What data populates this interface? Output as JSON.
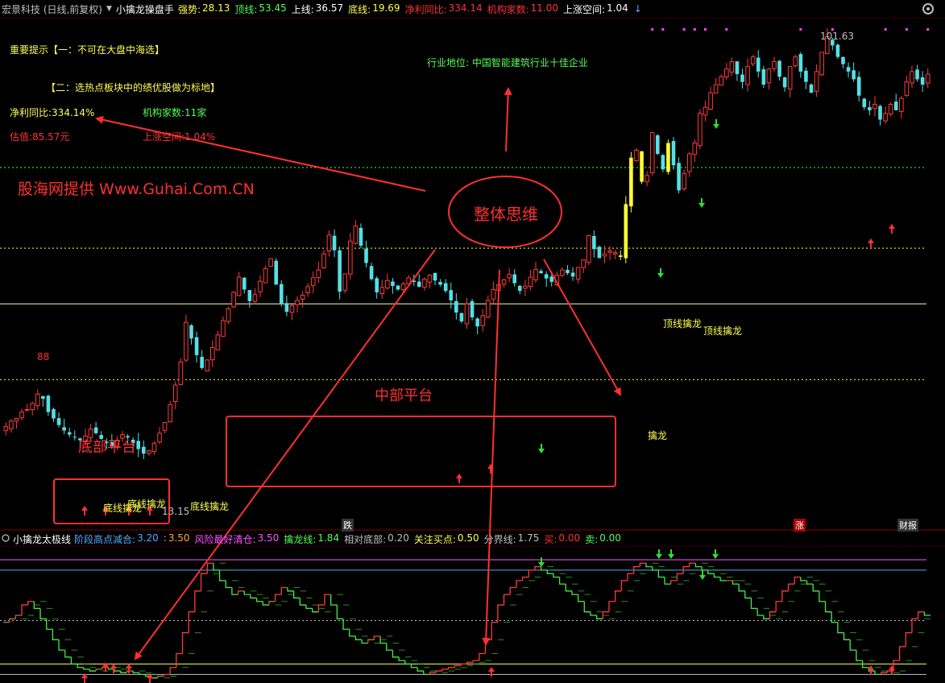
{
  "header": {
    "stock": "宏景科技 (日线,前复权)",
    "formula": "小擒龙操盘手",
    "items": [
      {
        "label": "强势:",
        "value": "28.13",
        "lc": "#ffff55",
        "vc": "#ffff55"
      },
      {
        "label": "顶线:",
        "value": "53.45",
        "lc": "#55ff55",
        "vc": "#55ff55"
      },
      {
        "label": "上线:",
        "value": "36.57",
        "lc": "#ffffff",
        "vc": "#ffffff"
      },
      {
        "label": "底线:",
        "value": "19.69",
        "lc": "#ffff55",
        "vc": "#ffff55"
      },
      {
        "label": "净利同比:",
        "value": "334.14",
        "lc": "#ff3333",
        "vc": "#ff3333"
      },
      {
        "label": "机构家数:",
        "value": "11.00",
        "lc": "#ff3333",
        "vc": "#ff3333"
      },
      {
        "label": "上涨空间:",
        "value": "1.04",
        "lc": "#ffffff",
        "vc": "#ffffff"
      }
    ]
  },
  "texts": {
    "tip1": "重要提示【一：不可在大盘中海选】",
    "tip2": "【二：选热点板块中的绩优股做为标地】",
    "profit": "净利同比:334.14%",
    "inst": "机构家数:11家",
    "valuation": "估值:85.57元",
    "upspace": "上涨空间:1.04%",
    "source": "股海网提供 Www.Guhai.Com.CN",
    "industry": "行业地位: 中国智能建筑行业十佳企业",
    "overall": "整体思维",
    "mid_platform": "中部平台",
    "bottom_platform": "底部平台",
    "level88": "88",
    "high_price": "101.63",
    "low_price": "13.15",
    "dieti": "跌",
    "zhang": "涨",
    "caibao": "财报",
    "sig_dixian1": "底线擒龙",
    "sig_dixian2": "底线擒龙",
    "sig_dixian3": "底线擒龙",
    "sig_qinlong": "擒龙",
    "sig_dingxian1": "顶线擒龙",
    "sig_dingxian2": "顶线擒龙"
  },
  "indicator": {
    "name": "小擒龙太极线",
    "items": [
      {
        "label": "阶段高点减合:",
        "value": "3.20",
        "lc": "#55aaff",
        "vc": "#55aaff"
      },
      {
        "label": ":",
        "value": "3.50",
        "lc": "#ffaa33",
        "vc": "#ffaa33"
      },
      {
        "label": "风险最好清仓:",
        "value": "3.50",
        "lc": "#ff55ff",
        "vc": "#ff55ff"
      },
      {
        "label": "擒龙线:",
        "value": "1.84",
        "lc": "#55ff55",
        "vc": "#55ff55"
      },
      {
        "label": "相对底部:",
        "value": "0.20",
        "lc": "#c0c0c0",
        "vc": "#c0c0c0"
      },
      {
        "label": "关注买点:",
        "value": "0.50",
        "lc": "#ffff55",
        "vc": "#ffff55"
      },
      {
        "label": "分界线:",
        "value": "1.75",
        "lc": "#c0c0c0",
        "vc": "#c0c0c0"
      },
      {
        "label": "买:",
        "value": "0.00",
        "lc": "#ff3333",
        "vc": "#ff3333"
      },
      {
        "label": "卖:",
        "value": "0.00",
        "lc": "#55ff55",
        "vc": "#55ff55"
      }
    ]
  },
  "chart_data": [
    {
      "type": "candlestick",
      "title": "宏景科技 (日线,前复权)",
      "y_range": [
        10,
        105
      ],
      "annotated_high": 101.63,
      "annotated_low": 13.15,
      "reference_lines": [
        {
          "name": "顶线",
          "value": 53.45,
          "color": "#55ff55"
        },
        {
          "name": "上线",
          "value": 36.57,
          "color": "#ffff55"
        },
        {
          "name": "底线",
          "value": 19.69,
          "color": "#ffff55"
        },
        {
          "name": "强势",
          "value": 28.13,
          "color": "#ffffaa"
        }
      ],
      "close_series": [
        15.8,
        16.2,
        16.4,
        16.9,
        17.1,
        17.6,
        18.4,
        18.0,
        16.9,
        16.4,
        15.9,
        15.5,
        15.2,
        15.0,
        14.8,
        15.1,
        15.6,
        15.3,
        14.9,
        14.6,
        14.4,
        14.8,
        15.2,
        15.0,
        14.6,
        14.2,
        13.9,
        14.1,
        14.6,
        15.3,
        16.1,
        17.5,
        19.2,
        21.4,
        25.8,
        23.9,
        22.1,
        20.8,
        21.6,
        22.9,
        24.3,
        26.0,
        27.5,
        29.7,
        31.9,
        30.1,
        28.5,
        29.4,
        31.3,
        33.2,
        34.8,
        30.8,
        28.2,
        27.1,
        27.9,
        28.6,
        29.3,
        30.5,
        31.8,
        33.0,
        35.6,
        38.9,
        36.2,
        29.8,
        32.4,
        37.8,
        40.6,
        37.0,
        34.1,
        31.6,
        29.7,
        30.4,
        31.4,
        30.6,
        30.1,
        30.9,
        31.8,
        31.2,
        30.5,
        31.6,
        32.2,
        31.4,
        30.8,
        29.9,
        28.6,
        27.0,
        25.9,
        28.1,
        26.4,
        25.3,
        26.6,
        28.6,
        30.1,
        30.8,
        31.5,
        32.3,
        31.0,
        29.9,
        30.6,
        31.9,
        33.1,
        32.5,
        31.7,
        31.2,
        32.2,
        33.0,
        32.5,
        32.0,
        33.4,
        34.6,
        38.8,
        36.4,
        34.9,
        35.6,
        36.1,
        35.8,
        35.1,
        45.0,
        56.0,
        58.0,
        50.0,
        51.5,
        63.0,
        57.0,
        53.0,
        60.0,
        54.0,
        48.0,
        52.0,
        57.0,
        60.0,
        69.0,
        71.0,
        76.0,
        79.0,
        82.0,
        85.0,
        88.0,
        83.0,
        80.0,
        86.0,
        90.0,
        84.0,
        79.0,
        85.0,
        88.0,
        82.0,
        78.0,
        86.0,
        90.0,
        84.0,
        80.0,
        76.0,
        84.0,
        92.0,
        99.0,
        95.0,
        90.0,
        87.0,
        84.0,
        81.0,
        75.0,
        71.0,
        70.0,
        72.0,
        67.0,
        69.0,
        72.0,
        70.0,
        74.0,
        80.0,
        84.0,
        81.0,
        79.0,
        83.0
      ]
    },
    {
      "type": "step-line",
      "title": "小擒龙太极线",
      "y_range": [
        0,
        3.8
      ],
      "reference_lines": [
        {
          "name": "风险最好清仓",
          "value": 3.5,
          "color": "#ff55ff"
        },
        {
          "name": "阶段高点减合",
          "value": 3.2,
          "color": "#55aaff"
        },
        {
          "name": "分界线",
          "value": 1.75,
          "color": "#c0c0c0"
        },
        {
          "name": "关注买点",
          "value": 0.5,
          "color": "#ffff55"
        },
        {
          "name": "相对底部",
          "value": 0.2,
          "color": "#c0c0c0"
        }
      ],
      "series": [
        {
          "name": "擒龙线",
          "values": [
            1.7,
            1.8,
            1.9,
            2.2,
            2.3,
            2.1,
            1.8,
            1.5,
            1.2,
            0.9,
            0.7,
            0.5,
            0.4,
            0.35,
            0.3,
            0.35,
            0.4,
            0.35,
            0.3,
            0.25,
            0.3,
            0.25,
            0.2,
            0.15,
            0.1,
            0.15,
            0.2,
            0.4,
            0.8,
            1.4,
            2.0,
            2.6,
            3.1,
            3.4,
            3.2,
            2.9,
            2.7,
            2.5,
            2.6,
            2.5,
            2.4,
            2.3,
            2.2,
            2.3,
            2.5,
            2.7,
            2.6,
            2.4,
            2.2,
            2.1,
            2.0,
            2.2,
            2.5,
            2.2,
            1.8,
            1.5,
            1.3,
            1.2,
            1.1,
            1.2,
            1.3,
            1.1,
            0.9,
            0.7,
            0.6,
            0.5,
            0.4,
            0.3,
            0.2,
            0.25,
            0.3,
            0.35,
            0.4,
            0.45,
            0.5,
            0.55,
            0.6,
            0.8,
            1.2,
            1.7,
            2.2,
            2.5,
            2.7,
            2.9,
            3.0,
            3.2,
            3.3,
            3.2,
            3.1,
            3.0,
            2.8,
            2.6,
            2.5,
            2.3,
            2.0,
            1.9,
            1.8,
            2.0,
            2.3,
            2.6,
            2.9,
            3.1,
            3.3,
            3.4,
            3.3,
            3.2,
            3.0,
            2.8,
            2.9,
            3.1,
            3.3,
            3.4,
            3.3,
            3.2,
            3.1,
            3.0,
            2.9,
            2.9,
            2.8,
            2.6,
            2.4,
            2.1,
            1.9,
            1.8,
            2.0,
            2.3,
            2.6,
            2.8,
            3.0,
            2.9,
            2.8,
            2.6,
            2.3,
            2.0,
            1.7,
            1.4,
            1.2,
            0.9,
            0.6,
            0.4,
            0.3,
            0.2,
            0.25,
            0.3,
            0.6,
            1.0,
            1.4,
            1.8,
            2.0,
            1.9
          ]
        }
      ]
    }
  ]
}
